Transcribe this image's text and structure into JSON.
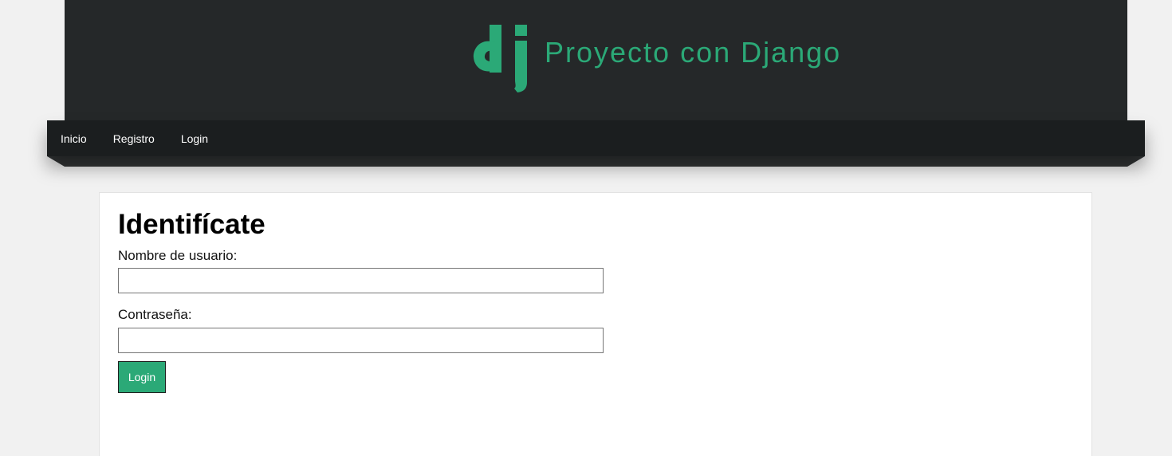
{
  "header": {
    "logo_icon": "django-dj-logo-icon",
    "title": "Proyecto con Django",
    "accent_color": "#2ba977"
  },
  "nav": {
    "items": [
      {
        "label": "Inicio"
      },
      {
        "label": "Registro"
      },
      {
        "label": "Login"
      }
    ]
  },
  "form": {
    "title": "Identifícate",
    "username_label": "Nombre de usuario:",
    "username_value": "",
    "password_label": "Contraseña:",
    "password_value": "",
    "submit_label": "Login"
  }
}
